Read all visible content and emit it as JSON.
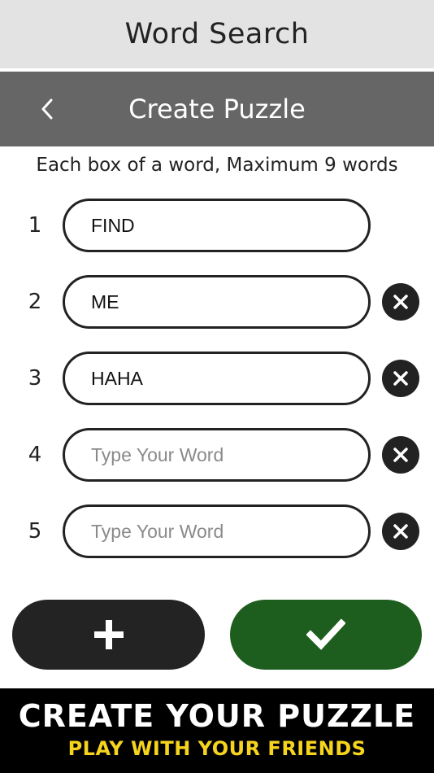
{
  "app_header": {
    "title": "Word Search"
  },
  "nav": {
    "title": "Create Puzzle",
    "back_icon": "chevron-left-icon"
  },
  "instructions": "Each box of a word, Maximum 9 words",
  "words": [
    {
      "number": "1",
      "value": "FIND",
      "placeholder": "Type Your Word",
      "removable": false
    },
    {
      "number": "2",
      "value": "ME",
      "placeholder": "Type Your Word",
      "removable": true
    },
    {
      "number": "3",
      "value": "HAHA",
      "placeholder": "Type Your Word",
      "removable": true
    },
    {
      "number": "4",
      "value": "",
      "placeholder": "Type Your Word",
      "removable": true
    },
    {
      "number": "5",
      "value": "",
      "placeholder": "Type Your Word",
      "removable": true
    }
  ],
  "actions": {
    "add_icon": "plus-icon",
    "confirm_icon": "checkmark-icon"
  },
  "promo": {
    "headline": "CREATE YOUR PUZZLE",
    "subline": "PLAY WITH YOUR FRIENDS"
  },
  "colors": {
    "header_bg": "#e3e3e3",
    "nav_bg": "#666666",
    "dark_button": "#232323",
    "confirm_button": "#1d5e1f",
    "promo_bg": "#000000",
    "promo_subline": "#f6d41e"
  }
}
